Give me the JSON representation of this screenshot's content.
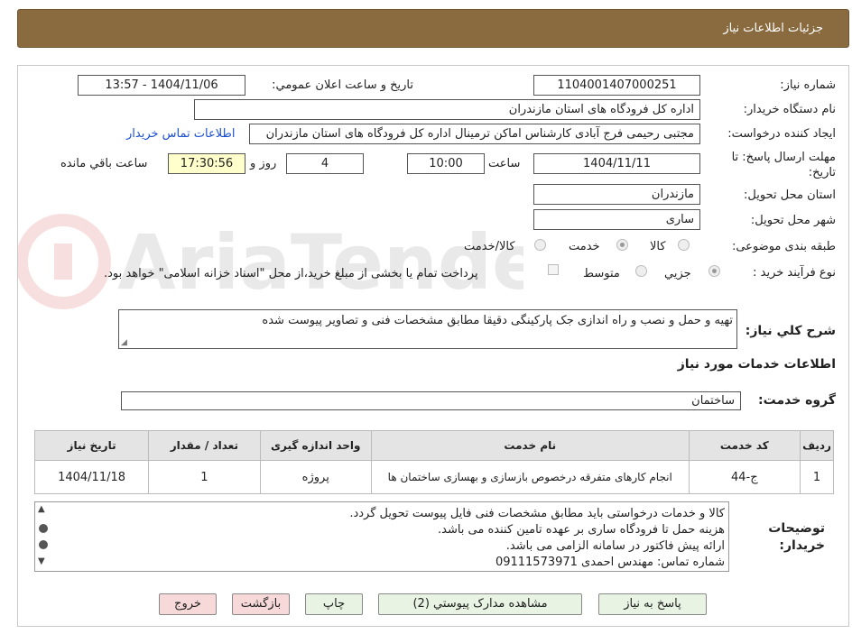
{
  "header": {
    "title": "جزئیات اطلاعات نیاز"
  },
  "form": {
    "need_number_label": "شماره نیاز:",
    "need_number": "1104001407000251",
    "announce_label": "تاریخ و ساعت اعلان عمومي:",
    "announce_value": "1404/11/06 - 13:57",
    "buyer_org_label": "نام دستگاه خریدار:",
    "buyer_org": "اداره کل فرودگاه های استان مازندران",
    "creator_label": "ایجاد کننده درخواست:",
    "creator": "مجتبی رحیمی فرج آبادی کارشناس اماکن ترمینال اداره کل فرودگاه های استان مازندران",
    "contact_link": "اطلاعات تماس خریدار",
    "deadline_label": "مهلت ارسال پاسخ: تا تاریخ:",
    "deadline_date": "1404/11/11",
    "time_label": "ساعت",
    "deadline_time": "10:00",
    "days_value": "4",
    "days_label": "روز و",
    "remaining_time": "17:30:56",
    "remaining_label": "ساعت باقي مانده",
    "province_label": "استان محل تحویل:",
    "province": "مازندران",
    "city_label": "شهر محل تحویل:",
    "city": "ساری",
    "category_label": "طبقه بندی موضوعی:",
    "category_options": [
      "کالا",
      "خدمت",
      "کالا/خدمت"
    ],
    "category_selected": "خدمت",
    "process_label": "نوع فرآیند خرید :",
    "process_options": [
      "جزيي",
      "متوسط"
    ],
    "process_selected": "جزيي",
    "payment_note": "پرداخت تمام یا بخشی از مبلغ خرید،از محل \"اسناد خزانه اسلامی\" خواهد بود.",
    "summary_label": "شرح كلي نياز:",
    "summary": "تهیه و حمل و نصب و راه اندازی جک پارکینگی دقیقا مطابق مشخصات فنی و تصاویر پیوست شده",
    "services_heading": "اطلاعات خدمات مورد نياز",
    "service_group_label": "گروه خدمت:",
    "service_group": "ساختمان"
  },
  "table": {
    "headers": [
      "ردیف",
      "کد خدمت",
      "نام خدمت",
      "واحد اندازه گیری",
      "تعداد / مقدار",
      "تاریخ نیاز"
    ],
    "rows": [
      [
        "1",
        "ج-44",
        "انجام کارهای متفرقه درخصوص بازسازی و بهسازی ساختمان ها",
        "پروژه",
        "1",
        "1404/11/18"
      ]
    ]
  },
  "buyer_notes": {
    "label": "توضیحات خریدار:",
    "lines": [
      "کالا و خدمات درخواستی باید مطابق مشخصات فنی فایل پیوست تحویل گردد.",
      "هزینه حمل تا فرودگاه ساری بر عهده تامین کننده می باشد.",
      "ارائه پیش فاکتور در سامانه الزامی می باشد.",
      "شماره تماس: مهندس احمدی    09111573971"
    ]
  },
  "buttons": {
    "reply": "پاسخ به نیاز",
    "attachments": "مشاهده مدارک پیوستي (2)",
    "print": "چاپ",
    "back": "بازگشت",
    "exit": "خروج"
  },
  "colors": {
    "header_bg": "#8a6b3f",
    "green_btn": "#e8f3e3",
    "pink_btn": "#f8d9d9",
    "remaining_bg": "#ffffcc"
  }
}
